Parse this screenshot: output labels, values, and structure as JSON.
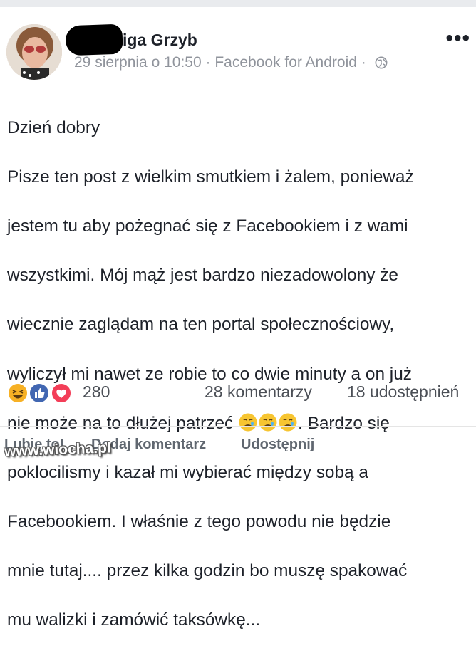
{
  "post": {
    "author_visible": "iga Grzyb",
    "date": "29 sierpnia o 10:50",
    "separator": " · ",
    "source": "Facebook for Android",
    "separator2": " · ",
    "more_label": "•••",
    "lines": {
      "l1": "Dzień dobry",
      "l2": "Pisze ten post z wielkim smutkiem i żalem, ponieważ",
      "l3": "jestem tu aby pożegnać się z Facebookiem i z wami",
      "l4": "wszystkimi. Mój mąż jest bardzo niezadowolony że",
      "l5": "wiecznie zaglądam na ten portal społecznościowy,",
      "l6": "wyliczył mi nawet ze robie to co dwie minuty a on już",
      "l7a": "nie może na to dłużej patrzeć ",
      "l7b": ". Bardzo się",
      "l8": "poklocilismy i kazał mi wybierać między sobą a",
      "l9": "Facebookiem. I właśnie z tego powodu nie będzie",
      "l10": "mnie tutaj.... przez kilka godzin bo muszę spakować",
      "l11": "mu walizki i zamówić taksówkę..."
    },
    "emojis": [
      "crying-face",
      "crying-face",
      "crying-face"
    ]
  },
  "stats": {
    "reaction_icons": [
      "laugh",
      "like",
      "love"
    ],
    "reactions_count": "280",
    "comments": "28 komentarzy",
    "shares": "18 udostępnień"
  },
  "actions": {
    "like": "Lubię to!",
    "comment": "Dodaj komentarz",
    "share": "Udostępnij"
  },
  "watermark": "www.wiocha.pl",
  "colors": {
    "text": "#1d2129",
    "meta": "#90949c",
    "like_blue": "#4267b2",
    "love_red": "#f33e58",
    "haha_yellow": "#f7b125"
  }
}
